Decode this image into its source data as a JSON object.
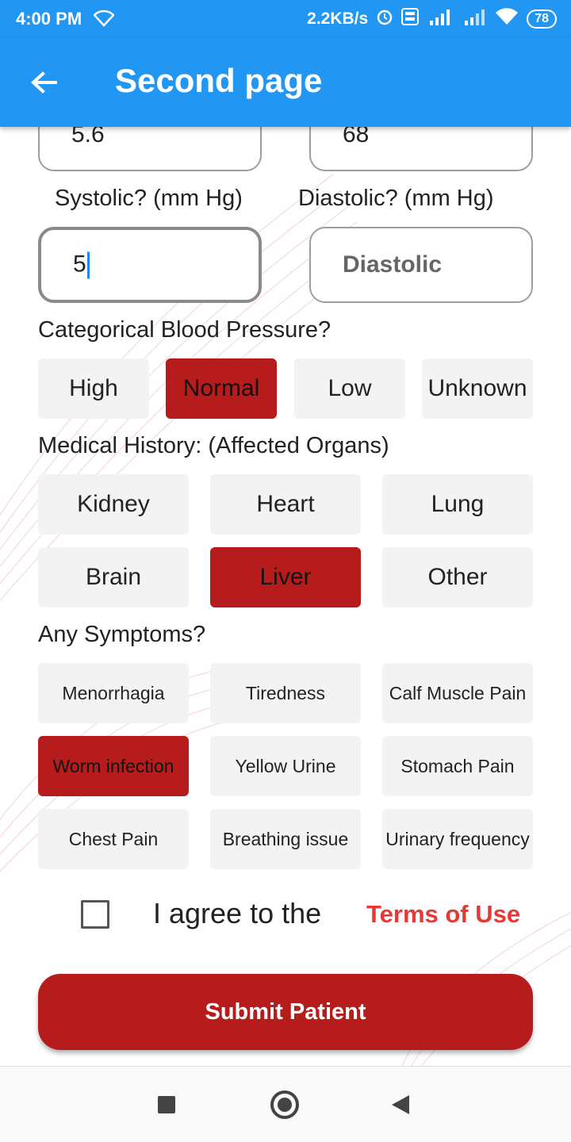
{
  "status_bar": {
    "time": "4:00 PM",
    "network_speed": "2.2KB/s",
    "battery": "78"
  },
  "app_bar": {
    "title": "Second page"
  },
  "top_fields": {
    "left_value": "5.6",
    "right_value": "68"
  },
  "blood_pressure": {
    "systolic_label": "Systolic? (mm Hg)",
    "diastolic_label": "Diastolic? (mm Hg)",
    "systolic_value": "5",
    "diastolic_placeholder": "Diastolic"
  },
  "categorical_bp": {
    "label": "Categorical Blood Pressure?",
    "options": [
      "High",
      "Normal",
      "Low",
      "Unknown"
    ],
    "selected": "Normal"
  },
  "medical_history": {
    "label": "Medical History: (Affected Organs)",
    "options": [
      "Kidney",
      "Heart",
      "Lung",
      "Brain",
      "Liver",
      "Other"
    ],
    "selected": [
      "Liver"
    ]
  },
  "symptoms": {
    "label": "Any Symptoms?",
    "options": [
      "Menorrhagia",
      "Tiredness",
      "Calf Muscle Pain",
      "Worm infection",
      "Yellow Urine",
      "Stomach Pain",
      "Chest Pain",
      "Breathing issue",
      "Urinary frequency"
    ],
    "selected": [
      "Worm infection"
    ]
  },
  "terms": {
    "agree_text": "I agree to the",
    "link_text": "Terms of Use",
    "checked": false
  },
  "submit": {
    "label": "Submit Patient"
  },
  "colors": {
    "primary": "#2196f3",
    "selected": "#b71c1c",
    "link": "#e53935"
  }
}
